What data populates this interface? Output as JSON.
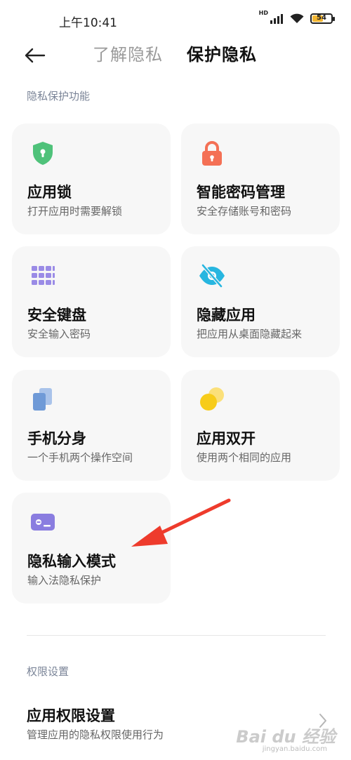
{
  "status": {
    "time": "上午10:41",
    "network": "HD",
    "battery": "54"
  },
  "header": {
    "tabs": [
      {
        "label": "了解隐私",
        "active": false
      },
      {
        "label": "保护隐私",
        "active": true
      }
    ]
  },
  "sections": {
    "privacy_features": "隐私保护功能",
    "permissions": "权限设置"
  },
  "cards": [
    {
      "title": "应用锁",
      "subtitle": "打开应用时需要解锁",
      "icon": "shield-icon",
      "color": "#4fc27a"
    },
    {
      "title": "智能密码管理",
      "subtitle": "安全存储账号和密码",
      "icon": "lock-icon",
      "color": "#f47055"
    },
    {
      "title": "安全键盘",
      "subtitle": "安全输入密码",
      "icon": "keyboard-icon",
      "color": "#9a8be6"
    },
    {
      "title": "隐藏应用",
      "subtitle": "把应用从桌面隐藏起来",
      "icon": "eye-off-icon",
      "color": "#27b6e0"
    },
    {
      "title": "手机分身",
      "subtitle": "一个手机两个操作空间",
      "icon": "dual-space-icon",
      "color": "#6f9ad7"
    },
    {
      "title": "应用双开",
      "subtitle": "使用两个相同的应用",
      "icon": "dual-app-icon",
      "color": "#f7cc1a"
    },
    {
      "title": "隐私输入模式",
      "subtitle": "输入法隐私保护",
      "icon": "private-input-icon",
      "color": "#8a7de0"
    }
  ],
  "permission_row": {
    "title": "应用权限设置",
    "subtitle": "管理应用的隐私权限使用行为"
  },
  "watermark": {
    "brand": "Bai du 经验",
    "url": "jingyan.baidu.com"
  },
  "colors": {
    "arrow": "#ee3b2c",
    "section_title": "#7b8598",
    "card_bg": "#f7f7f7"
  }
}
